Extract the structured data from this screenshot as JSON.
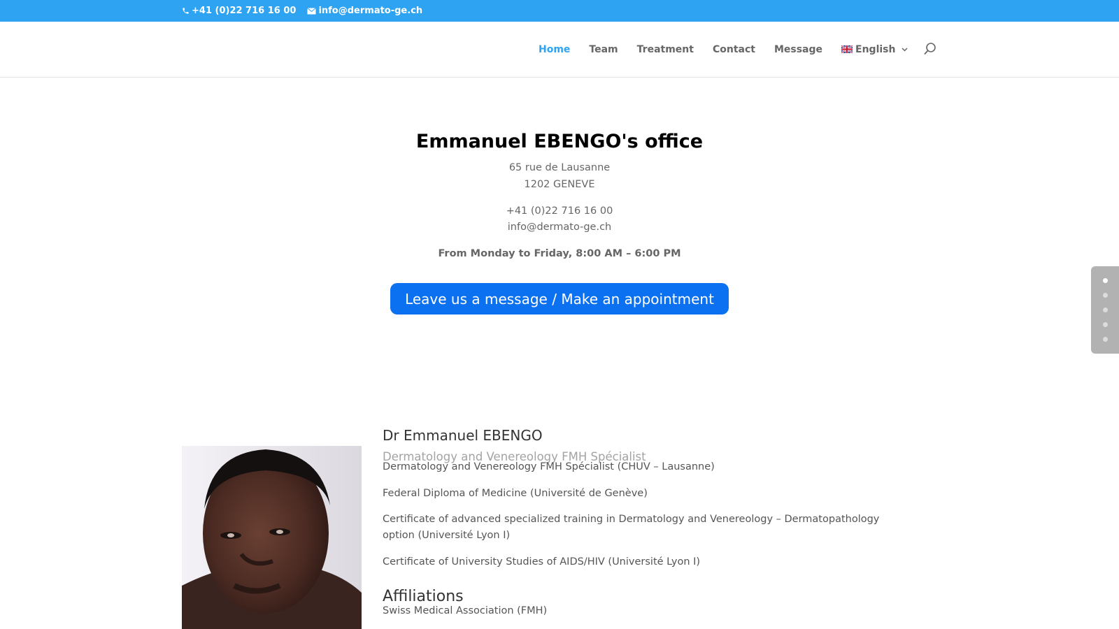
{
  "top_bar": {
    "phone": "+41 (0)22 716 16 00",
    "email": "info@dermato-ge.ch",
    "background": "#2ea3f2"
  },
  "nav": {
    "items": [
      {
        "label": "Home",
        "active": true
      },
      {
        "label": "Team",
        "active": false
      },
      {
        "label": "Treatment",
        "active": false
      },
      {
        "label": "Contact",
        "active": false
      },
      {
        "label": "Message",
        "active": false
      }
    ],
    "language": "English",
    "icons": {
      "language_flag": "uk-flag-icon",
      "dropdown": "chevron-down-icon",
      "search": "search-icon"
    }
  },
  "hero": {
    "title": "Emmanuel EBENGO's office",
    "address_line1": "65 rue de Lausanne",
    "address_line2": "1202 GENEVE",
    "phone": "+41 (0)22 716 16 00",
    "email": "info@dermato-ge.ch",
    "hours": "From Monday to Friday, 8:00 AM – 6:00 PM",
    "cta_label": "Leave us a message / Make an appointment",
    "cta_color": "#0c71f0"
  },
  "dot_nav": {
    "count": 5,
    "active_index": 0
  },
  "doctor": {
    "name": "Dr Emmanuel EBENGO",
    "specialty": "Dermatology and Venereology FMH Spécialist",
    "qualifications": [
      "Dermatology and Venereology FMH Spécialist (CHUV – Lausanne)",
      "Federal Diploma of Medicine (Université de Genève)",
      "Certificate of advanced specialized training in Dermatology and Venereology – Dermatopathology option (Université Lyon I)",
      "Certificate of University Studies of AIDS/HIV (Université Lyon I)"
    ],
    "affiliations_heading": "Affiliations",
    "affiliations": [
      "Swiss Medical Association (FMH)"
    ]
  },
  "colors": {
    "accent": "#2ea3f2",
    "text": "#666666"
  }
}
